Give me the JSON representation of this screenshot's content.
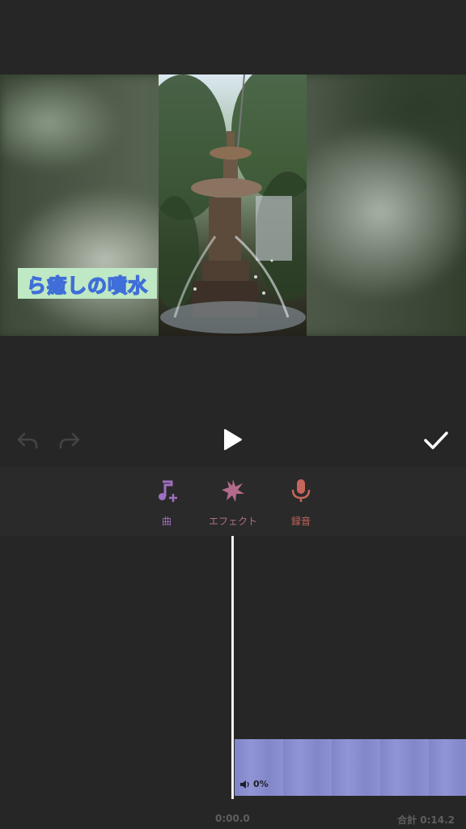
{
  "caption": {
    "text": "ら癒しの噴水"
  },
  "controls": {
    "undo_icon": "undo-arrow-icon",
    "redo_icon": "redo-arrow-icon",
    "play_icon": "play-icon",
    "confirm_icon": "checkmark-icon"
  },
  "toolbar": {
    "items": [
      {
        "label": "曲",
        "icon": "music-note-plus-icon",
        "color": "#a06fc0"
      },
      {
        "label": "エフェクト",
        "icon": "sparkle-burst-icon",
        "color": "#b36b8c"
      },
      {
        "label": "録音",
        "icon": "microphone-icon",
        "color": "#c4675a"
      }
    ]
  },
  "timeline": {
    "clip": {
      "volume": "0%",
      "volume_icon": "speaker-icon",
      "color": "#8a8fd0"
    },
    "current_time": "0:00.0",
    "total_time": "合計 0:14.2"
  },
  "colors": {
    "background": "#262626",
    "toolbar": "#2a2a2a",
    "caption_bg": "#bfe8c4",
    "caption_stroke": "#3f6ed9"
  }
}
